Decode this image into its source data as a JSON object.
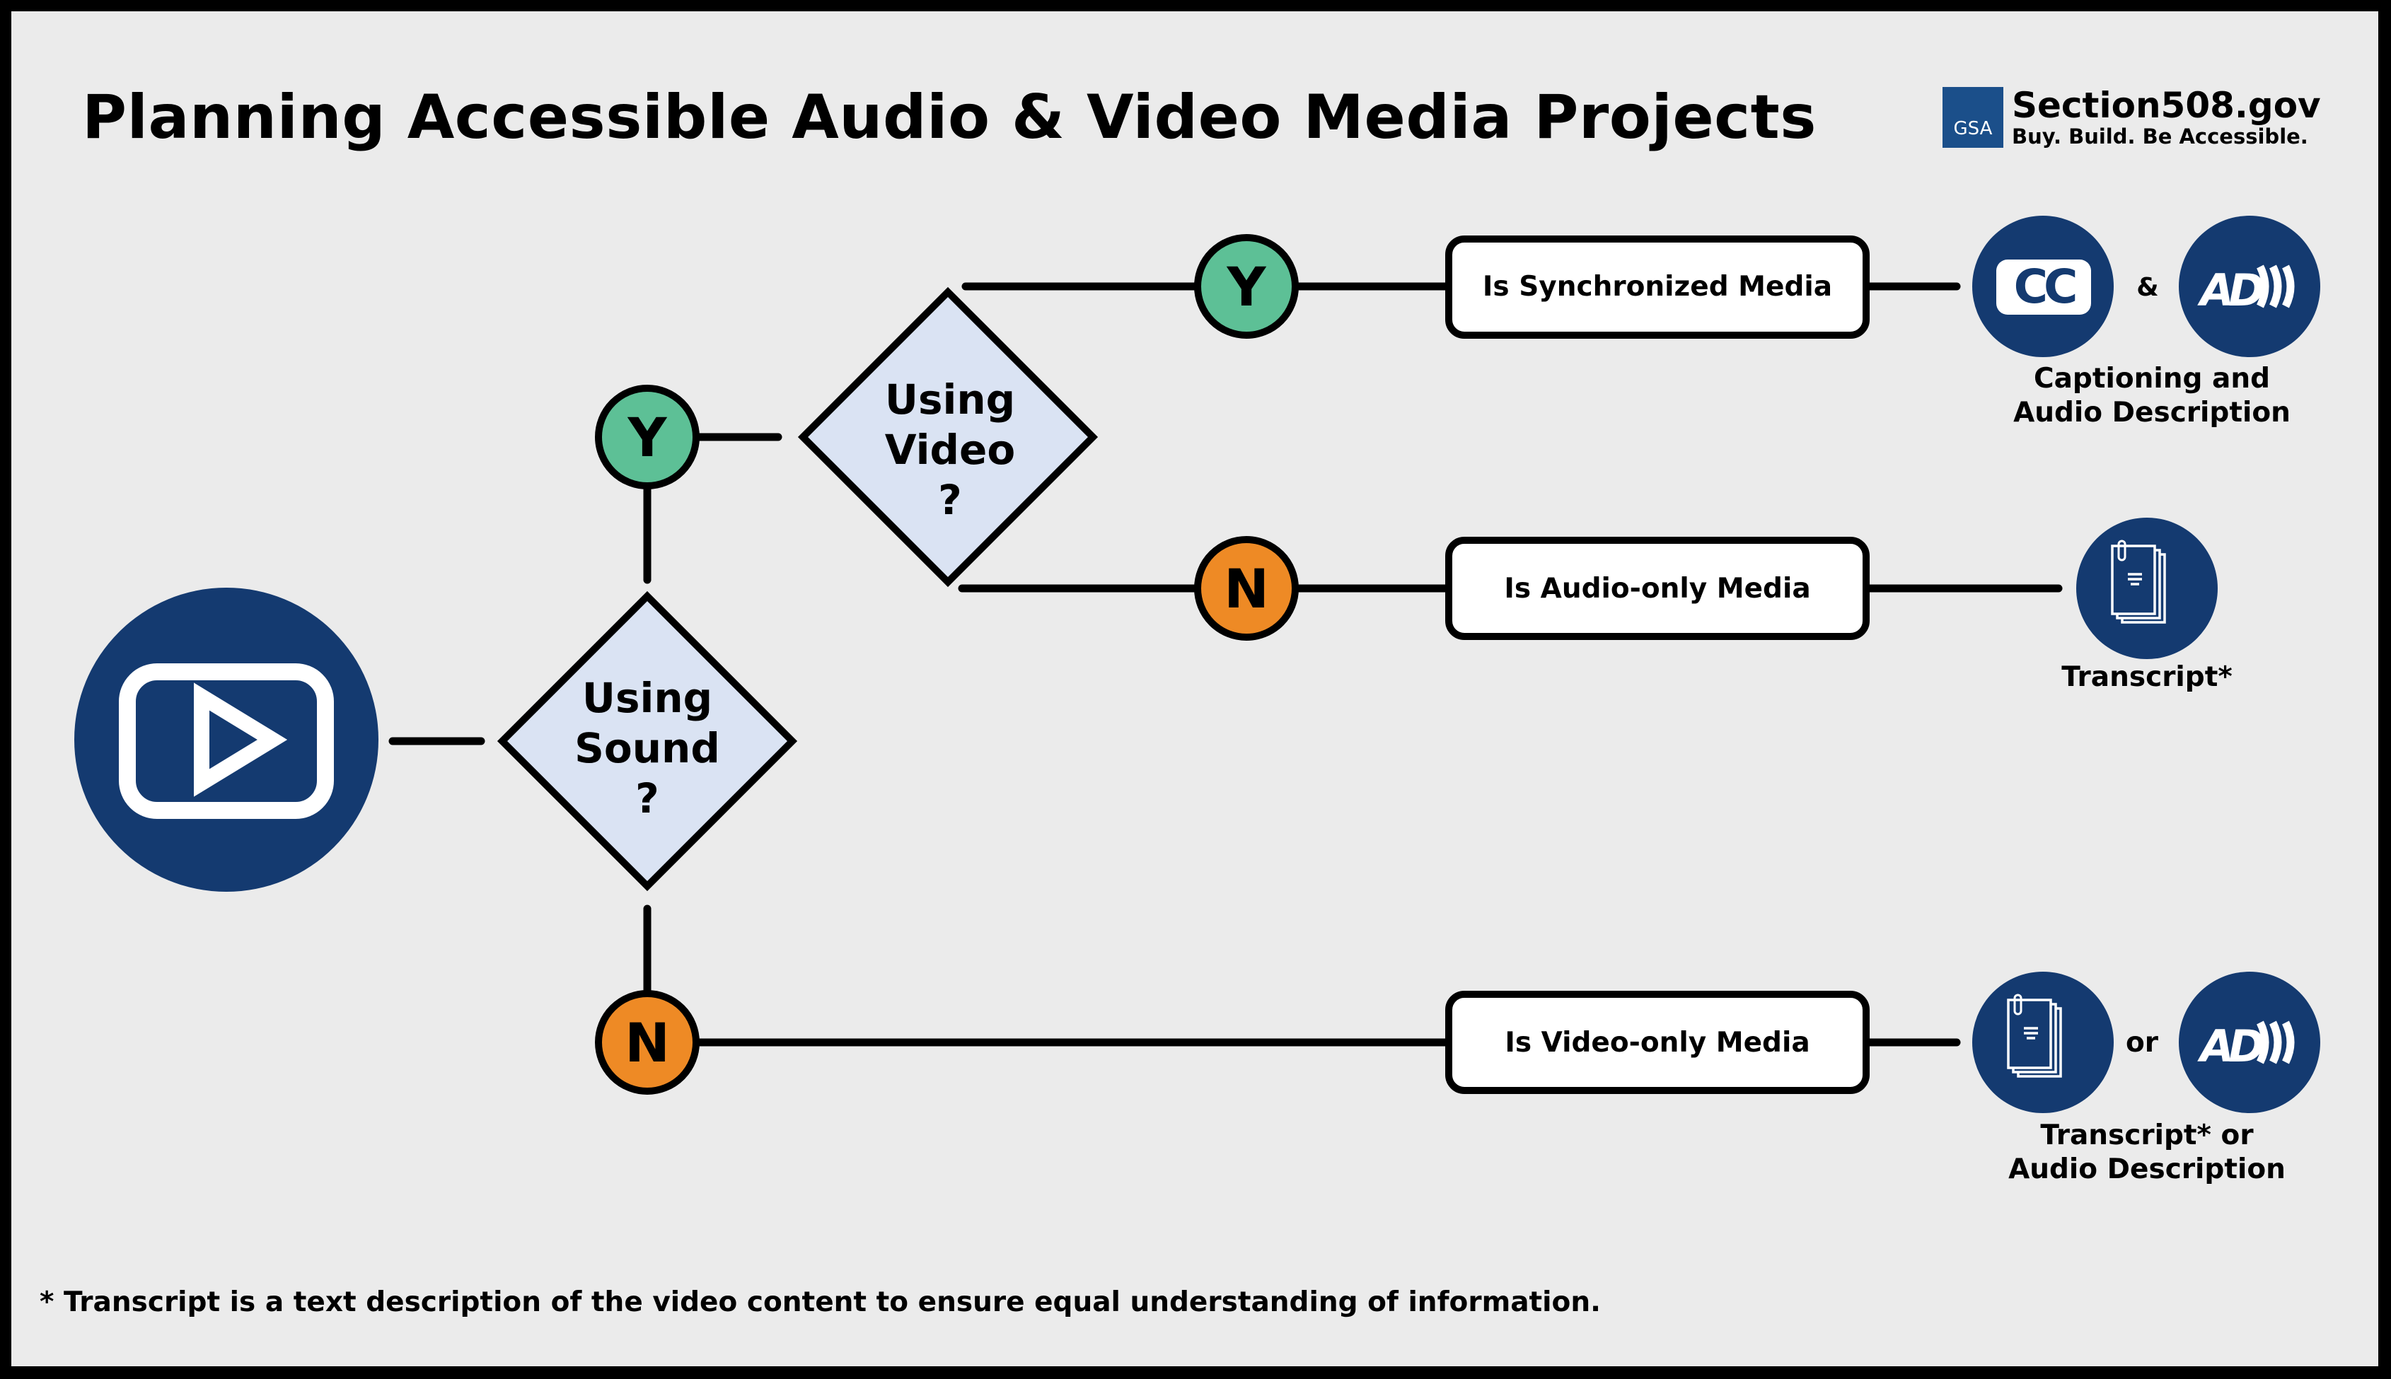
{
  "title": "Planning Accessible Audio & Video Media Projects",
  "logo": {
    "badge": "GSA",
    "name": "Section508.gov",
    "tagline": "Buy. Build. Be Accessible."
  },
  "colors": {
    "navy": "#143a70",
    "yes_green": "#5dc096",
    "no_orange": "#ee8a25",
    "decision_fill": "#dae3f3",
    "background": "#ebebeb"
  },
  "start_icon": "video-play-icon",
  "decisions": {
    "sound": {
      "lines": [
        "Using",
        "Sound",
        "?"
      ]
    },
    "video": {
      "lines": [
        "Using",
        "Video",
        "?"
      ]
    }
  },
  "answers": {
    "sound_yes": "Y",
    "sound_no": "N",
    "video_yes": "Y",
    "video_no": "N"
  },
  "outcomes": {
    "synchronized": {
      "label": "Is Synchronized Media",
      "icons": [
        "closed-captions-icon",
        "audio-description-icon"
      ],
      "icon_cc_text": "CC",
      "icon_ad_text": "AD",
      "joiner": "&",
      "caption_lines": [
        "Captioning and",
        "Audio Description"
      ]
    },
    "audio_only": {
      "label": "Is Audio-only Media",
      "icons": [
        "transcript-icon"
      ],
      "caption_lines": [
        "Transcript*"
      ]
    },
    "video_only": {
      "label": "Is Video-only Media",
      "icons": [
        "transcript-icon",
        "audio-description-icon"
      ],
      "icon_ad_text": "AD",
      "joiner": "or",
      "caption_lines": [
        "Transcript* or",
        "Audio Description"
      ]
    }
  },
  "footnote": "* Transcript is a text description of the video content to ensure equal understanding of information."
}
